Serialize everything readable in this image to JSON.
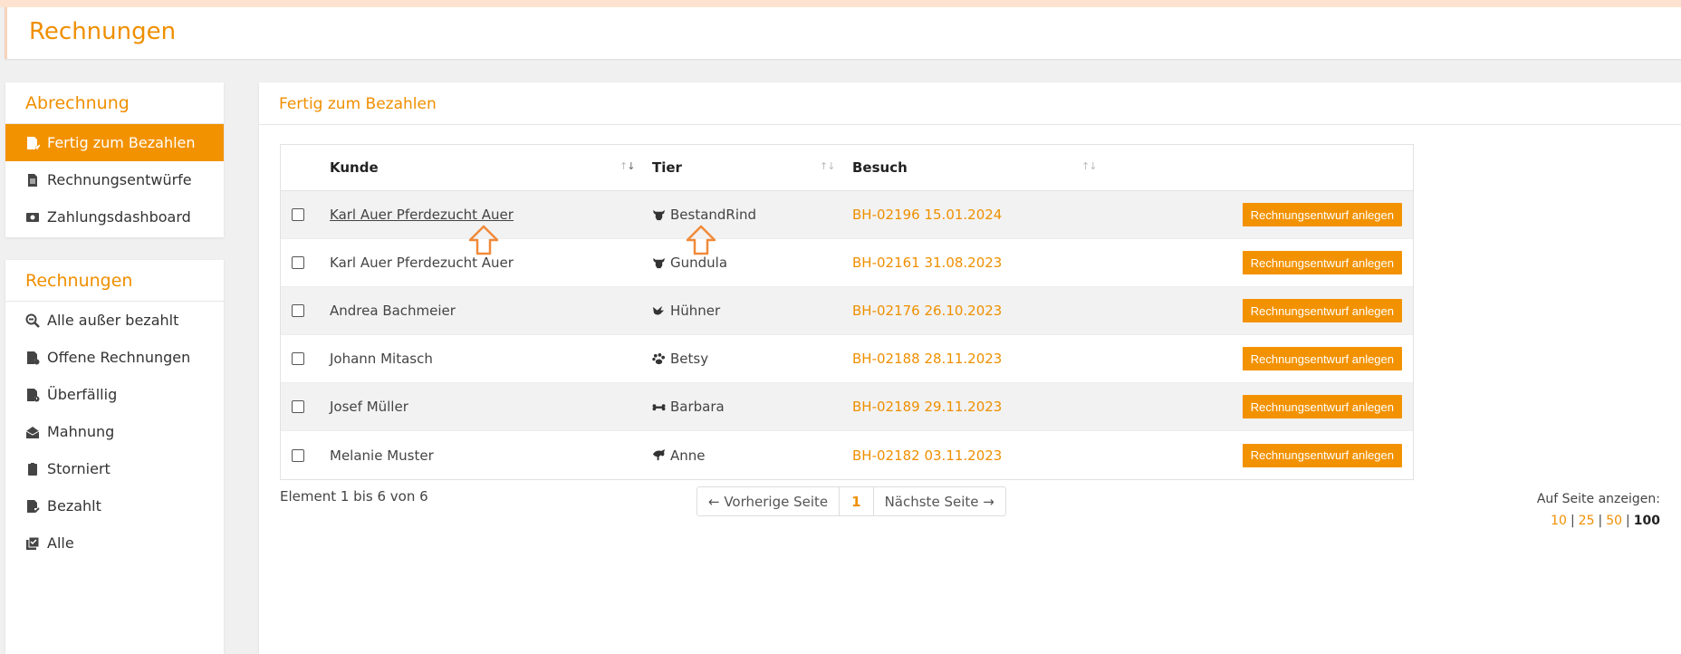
{
  "page": {
    "title": "Rechnungen"
  },
  "colors": {
    "accent": "#f39200",
    "accent_text": "#ef8f00"
  },
  "sidebar": {
    "abrechnung": {
      "title": "Abrechnung",
      "items": [
        {
          "label": "Fertig zum Bezahlen",
          "icon": "invoice-ready-icon",
          "active": true
        },
        {
          "label": "Rechnungsentwürfe",
          "icon": "invoice-draft-icon"
        },
        {
          "label": "Zahlungsdashboard",
          "icon": "money-icon"
        }
      ]
    },
    "rechnungen": {
      "title": "Rechnungen",
      "items": [
        {
          "label": "Alle außer bezahlt",
          "icon": "search-minus-icon"
        },
        {
          "label": "Offene Rechnungen",
          "icon": "invoice-open-icon"
        },
        {
          "label": "Überfällig",
          "icon": "invoice-overdue-icon"
        },
        {
          "label": "Mahnung",
          "icon": "mail-open-icon"
        },
        {
          "label": "Storniert",
          "icon": "clipboard-icon"
        },
        {
          "label": "Bezahlt",
          "icon": "invoice-paid-icon"
        },
        {
          "label": "Alle",
          "icon": "checkbox-stack-icon"
        }
      ]
    }
  },
  "main": {
    "title": "Fertig zum Bezahlen",
    "columns": {
      "kunde": "Kunde",
      "tier": "Tier",
      "besuch": "Besuch"
    },
    "action_label": "Rechnungsentwurf anlegen",
    "rows": [
      {
        "kunde": "Karl Auer Pferdezucht Auer",
        "tier": "BestandRind",
        "animal_icon": "cow-icon",
        "besuch": "BH-02196 15.01.2024"
      },
      {
        "kunde": "Karl Auer Pferdezucht Auer",
        "tier": "Gundula",
        "animal_icon": "cow-icon",
        "besuch": "BH-02161 31.08.2023"
      },
      {
        "kunde": "Andrea Bachmeier",
        "tier": "Hühner",
        "animal_icon": "bird-icon",
        "besuch": "BH-02176 26.10.2023"
      },
      {
        "kunde": "Johann Mitasch",
        "tier": "Betsy",
        "animal_icon": "paw-icon",
        "besuch": "BH-02188 28.11.2023"
      },
      {
        "kunde": "Josef Müller",
        "tier": "Barbara",
        "animal_icon": "bone-icon",
        "besuch": "BH-02189 29.11.2023"
      },
      {
        "kunde": "Melanie Muster",
        "tier": "Anne",
        "animal_icon": "horse-icon",
        "besuch": "BH-02182 03.11.2023"
      }
    ],
    "info": "Element 1 bis 6 von 6",
    "pager": {
      "prev": "← Vorherige Seite",
      "current": "1",
      "next": "Nächste Seite →"
    },
    "per_page": {
      "label": "Auf Seite anzeigen:",
      "options": [
        "10",
        "25",
        "50",
        "100"
      ],
      "selected": "100"
    }
  }
}
